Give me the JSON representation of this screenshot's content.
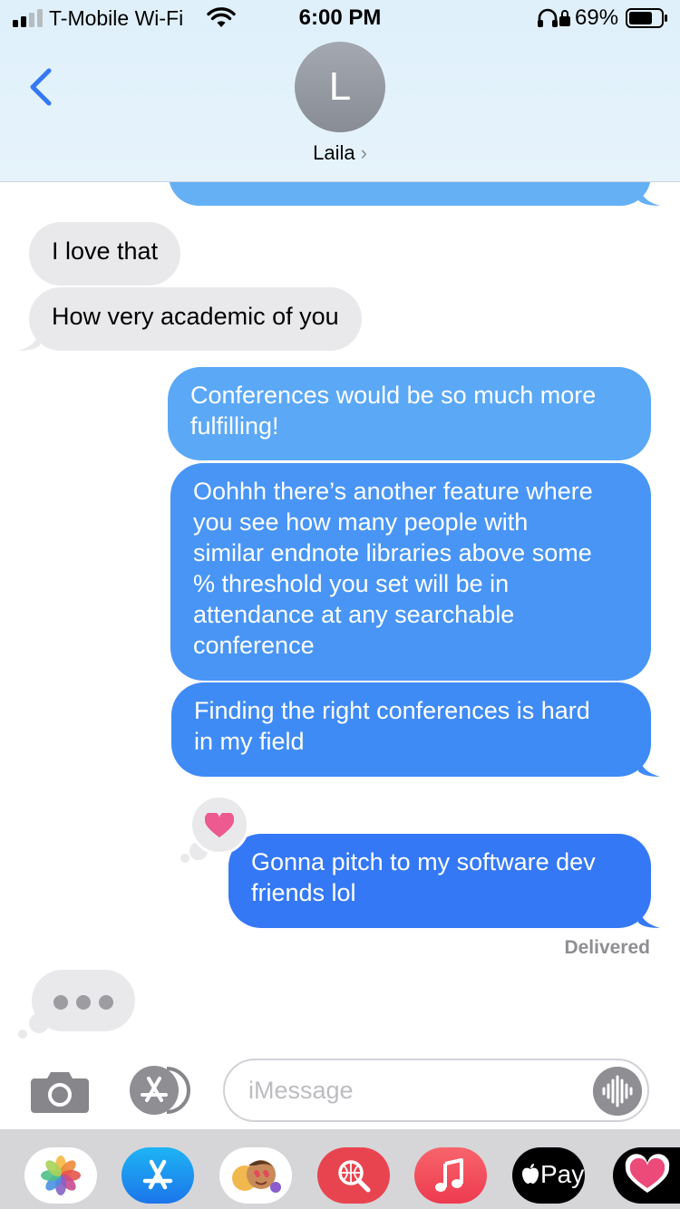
{
  "status_bar": {
    "carrier": "T-Mobile Wi-Fi",
    "time": "6:00 PM",
    "battery_percent": "69%"
  },
  "header": {
    "contact_initial": "L",
    "contact_name": "Laila",
    "chevron": "›",
    "back_icon": "chevron-left-icon"
  },
  "messages": [
    {
      "side": "received",
      "text": "I love that"
    },
    {
      "side": "received",
      "text": "How very academic of you"
    },
    {
      "side": "sent",
      "lines": [
        "Conferences would be so much more",
        "fulfilling!"
      ]
    },
    {
      "side": "sent",
      "lines": [
        "Oohhh there’s another feature where",
        "you see how many people with",
        "similar endnote libraries above some",
        "% threshold you set will be in",
        "attendance at any searchable",
        "conference"
      ]
    },
    {
      "side": "sent",
      "lines": [
        "Finding the right conferences is hard",
        "in my field"
      ]
    },
    {
      "side": "sent",
      "lines": [
        "Gonna pitch to my software dev",
        "friends lol"
      ],
      "reaction": "heart-icon"
    }
  ],
  "delivered_label": "Delivered",
  "input": {
    "placeholder": "iMessage"
  },
  "app_drawer": [
    "photos-icon",
    "app-store-icon",
    "memoji-icon",
    "web-search-icon",
    "music-icon",
    "apple-pay-icon",
    "heart-app-icon"
  ],
  "apple_pay_label": "Pay",
  "colors": {
    "sent_top": "#63b0f6",
    "sent_bottom": "#3478f6",
    "received": "#e9e9eb",
    "header_bg": "#e0f0fb",
    "heart": "#ec5a8f"
  }
}
